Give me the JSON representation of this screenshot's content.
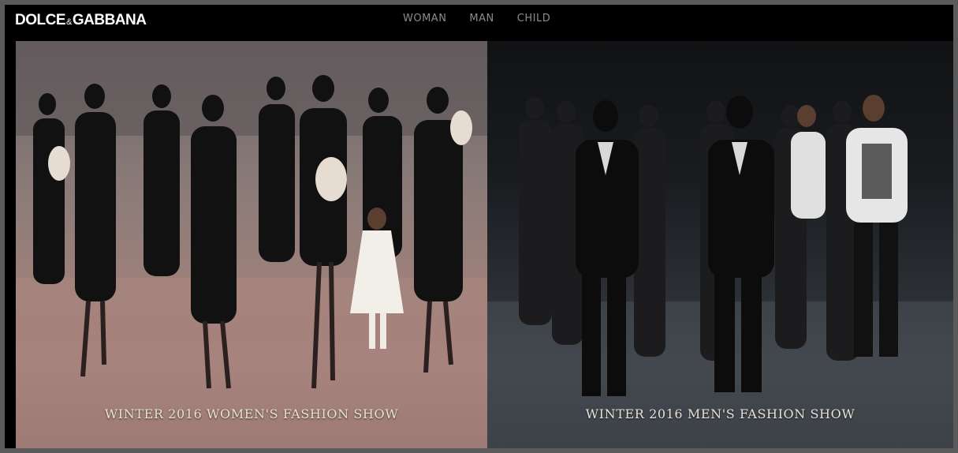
{
  "brand": {
    "logo_left": "DOLCE",
    "logo_amp": "&",
    "logo_right": "GABBANA"
  },
  "nav": {
    "items": [
      {
        "label": "WOMAN"
      },
      {
        "label": "MAN"
      },
      {
        "label": "CHILD"
      }
    ]
  },
  "panels": {
    "women": {
      "caption": "WINTER 2016 WOMEN'S FASHION SHOW"
    },
    "men": {
      "caption": "WINTER 2016 MEN'S FASHION SHOW"
    }
  },
  "colors": {
    "page_bg": "#000000",
    "nav_text": "#8b8b8b",
    "logo_text": "#ffffff",
    "caption_text": "#e8e2d8"
  }
}
